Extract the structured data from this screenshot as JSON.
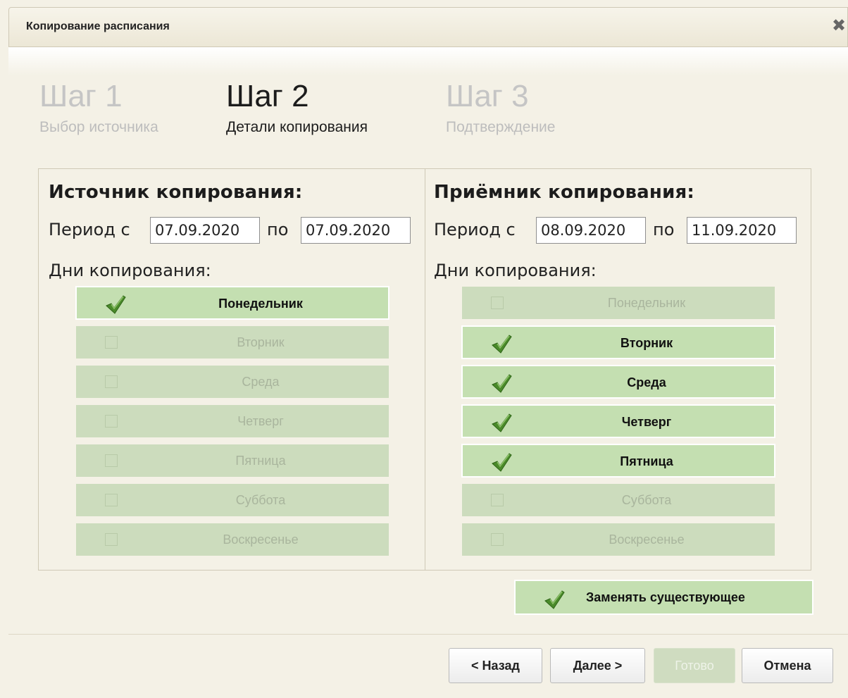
{
  "dialog": {
    "title": "Копирование расписания",
    "close_icon": "close-icon"
  },
  "steps": [
    {
      "num": "Шаг 1",
      "desc": "Выбор источника",
      "state": "inactive"
    },
    {
      "num": "Шаг 2",
      "desc": "Детали копирования",
      "state": "active"
    },
    {
      "num": "Шаг 3",
      "desc": "Подтверждение",
      "state": "inactive"
    }
  ],
  "source": {
    "heading": "Источник копирования:",
    "period_from_label": "Период с",
    "period_to_label": "по",
    "date_from": "07.09.2020",
    "date_to": "07.09.2020",
    "days_label": "Дни копирования:",
    "days": [
      {
        "label": "Понедельник",
        "checked": true
      },
      {
        "label": "Вторник",
        "checked": false
      },
      {
        "label": "Среда",
        "checked": false
      },
      {
        "label": "Четверг",
        "checked": false
      },
      {
        "label": "Пятница",
        "checked": false
      },
      {
        "label": "Суббота",
        "checked": false
      },
      {
        "label": "Воскресенье",
        "checked": false
      }
    ]
  },
  "target": {
    "heading": "Приёмник копирования:",
    "period_from_label": "Период с",
    "period_to_label": "по",
    "date_from": "08.09.2020",
    "date_to": "11.09.2020",
    "days_label": "Дни копирования:",
    "days": [
      {
        "label": "Понедельник",
        "checked": false
      },
      {
        "label": "Вторник",
        "checked": true
      },
      {
        "label": "Среда",
        "checked": true
      },
      {
        "label": "Четверг",
        "checked": true
      },
      {
        "label": "Пятница",
        "checked": true
      },
      {
        "label": "Суббота",
        "checked": false
      },
      {
        "label": "Воскресенье",
        "checked": false
      }
    ]
  },
  "replace_existing": {
    "label": "Заменять существующее",
    "checked": true
  },
  "buttons": {
    "back": "< Назад",
    "next": "Далее >",
    "done": "Готово",
    "cancel": "Отмена"
  },
  "colors": {
    "checked_bg": "#c4dfb1",
    "unchecked_bg": "#ccdcbd",
    "check_mark": "#4a8a2a",
    "dialog_bg": "#f4f1e6"
  }
}
